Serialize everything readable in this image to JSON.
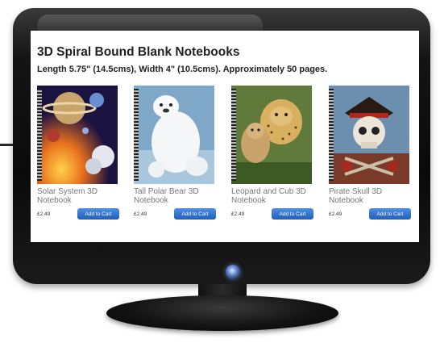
{
  "page": {
    "title": "3D Spiral Bound Blank Notebooks",
    "subtitle": "Length 5.75\" (14.5cms), Width 4\" (10.5cms).   Approximately 50 pages."
  },
  "products": [
    {
      "name": "Solar System 3D Notebook",
      "price": "£2.49",
      "button": "Add to Cart"
    },
    {
      "name": "Tall Polar Bear 3D Notebook",
      "price": "£2.49",
      "button": "Add to Cart"
    },
    {
      "name": "Leopard and Cub 3D Notebook",
      "price": "£2.49",
      "button": "Add to Cart"
    },
    {
      "name": "Pirate Skull 3D Notebook",
      "price": "£2.49",
      "button": "Add to Cart"
    }
  ],
  "colors": {
    "button": "#2a6dc8",
    "bezel": "#111111",
    "power_glow": "#6d8fd6"
  },
  "icons": [
    "power-icon"
  ]
}
